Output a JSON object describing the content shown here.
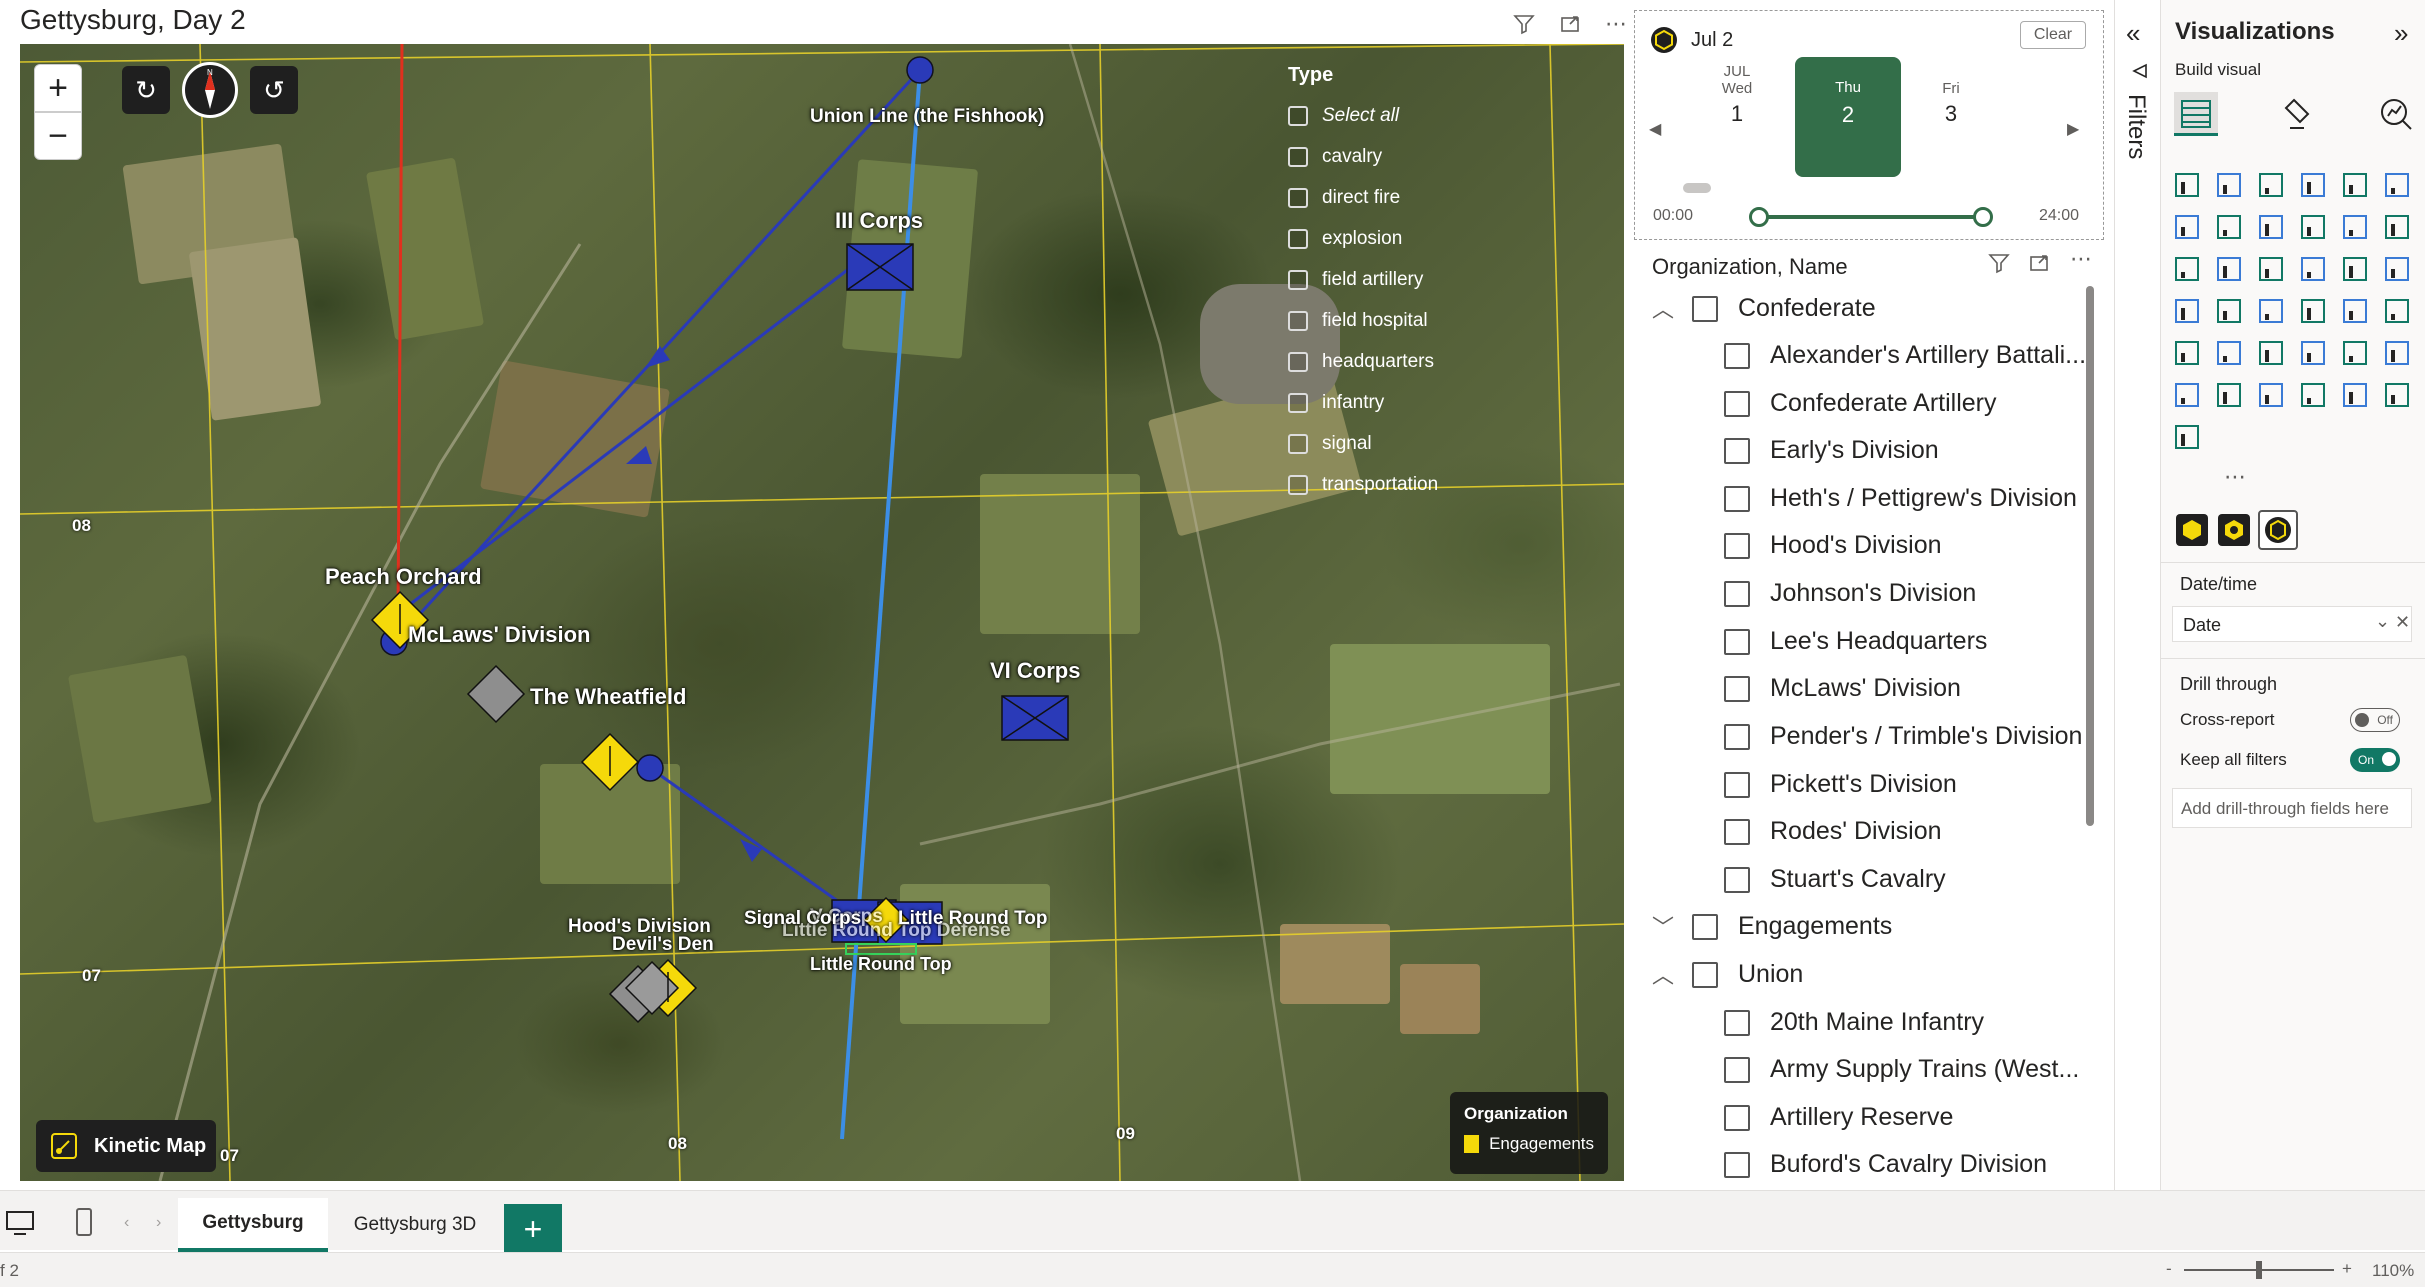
{
  "report": {
    "title": "Gettysburg, Day 2"
  },
  "timeline": {
    "selected_label": "Jul 2",
    "clear_label": "Clear",
    "days": [
      {
        "month": "JUL",
        "weekday": "Wed",
        "day": "1"
      },
      {
        "month": "",
        "weekday": "Thu",
        "day": "2"
      },
      {
        "month": "",
        "weekday": "Fri",
        "day": "3"
      }
    ],
    "range_start": "00:00",
    "range_end": "24:00",
    "accent": "#336e49"
  },
  "map": {
    "type_legend": {
      "title": "Type",
      "items": [
        "Select all",
        "cavalry",
        "direct fire",
        "explosion",
        "field artillery",
        "field hospital",
        "headquarters",
        "infantry",
        "signal",
        "transportation"
      ]
    },
    "labels": {
      "union_line": "Union Line (the Fishhook)",
      "iii_corps": "III Corps",
      "peach_orchard": "Peach Orchard",
      "mclaws": "McLaws' Division",
      "wheatfield": "The Wheatfield",
      "vi_corps": "VI Corps",
      "signal_corps": "Signal Corps",
      "v_corps": "V Corps",
      "lrt_defense": "Little Round Top Defense",
      "little_round_top_top": "Little Round Top",
      "little_round_top_bottom": "Little Round Top",
      "hoods": "Hood's Division",
      "devils_den": "Devil's Den"
    },
    "grid_labels": [
      "08",
      "07",
      "07",
      "08",
      "09"
    ],
    "kinetic_label": "Kinetic Map",
    "org_legend": {
      "title": "Organization",
      "item": "Engagements",
      "color": "#f5d90a"
    },
    "zoom_in": "+",
    "zoom_out": "−"
  },
  "org_slicer": {
    "header": "Organization, Name",
    "groups": [
      {
        "name": "Confederate",
        "expanded": true,
        "items": [
          "Alexander's Artillery Battali...",
          "Confederate Artillery",
          "Early's Division",
          "Heth's / Pettigrew's Division",
          "Hood's Division",
          "Johnson's Division",
          "Lee's Headquarters",
          "McLaws' Division",
          "Pender's / Trimble's Division",
          "Pickett's Division",
          "Rodes' Division",
          "Stuart's Cavalry"
        ]
      },
      {
        "name": "Engagements",
        "expanded": false,
        "items": []
      },
      {
        "name": "Union",
        "expanded": true,
        "items": [
          "20th Maine Infantry",
          "Army Supply Trains (West...",
          "Artillery Reserve",
          "Buford's Cavalry Division"
        ]
      }
    ]
  },
  "filters": {
    "label": "Filters"
  },
  "visualizations": {
    "title": "Visualizations",
    "build_visual": "Build visual",
    "date_time_label": "Date/time",
    "date_field": "Date",
    "drill_through": "Drill through",
    "cross_report": "Cross-report",
    "cross_report_state": "Off",
    "keep_all_filters": "Keep all filters",
    "keep_all_filters_state": "On",
    "add_drill": "Add drill-through fields here",
    "more": "⋯"
  },
  "pages": {
    "tabs": [
      "Gettysburg",
      "Gettysburg 3D"
    ],
    "add": "+"
  },
  "status": {
    "page_info": "f 2",
    "zoom": "110%",
    "zoom_minus": "-",
    "zoom_plus": "+"
  }
}
